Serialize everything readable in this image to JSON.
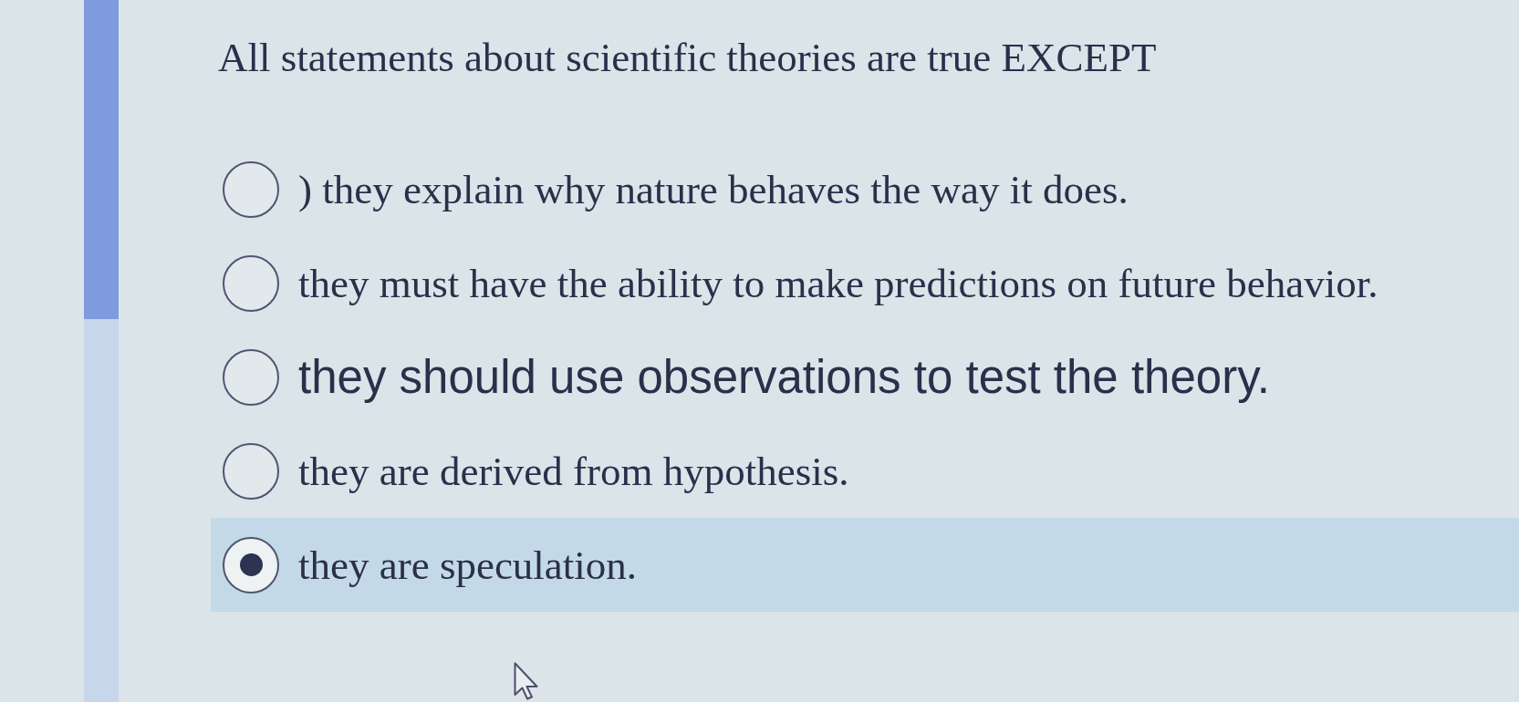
{
  "question": {
    "text": "All statements about scientific theories are true EXCEPT"
  },
  "options": [
    {
      "label": ") they explain why nature behaves the way it does.",
      "kind": "serif",
      "selected": false
    },
    {
      "label": "they must have the ability to make predictions on future behavior.",
      "kind": "serif",
      "selected": false
    },
    {
      "label": "they should use observations to test the theory.",
      "kind": "sans",
      "selected": false
    },
    {
      "label": "they are derived from hypothesis.",
      "kind": "serif",
      "selected": false
    },
    {
      "label": "they are speculation.",
      "kind": "serif",
      "selected": true
    }
  ]
}
